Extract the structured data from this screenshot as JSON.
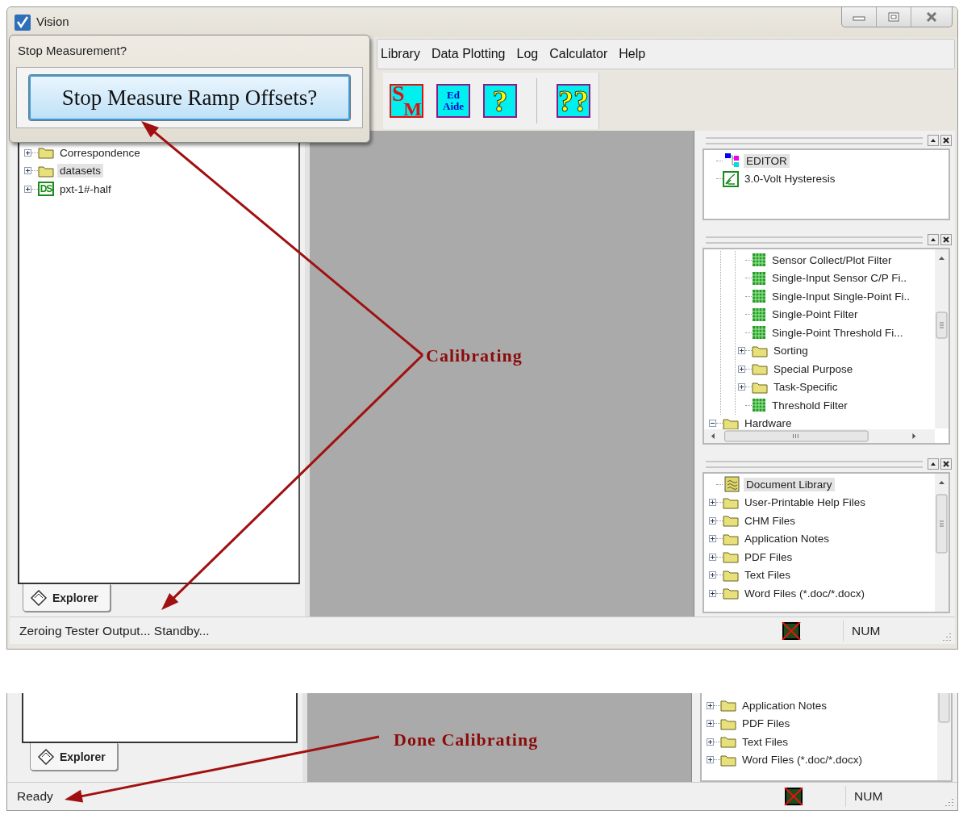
{
  "window": {
    "title": "Vision"
  },
  "dialog": {
    "title": "Stop Measurement?",
    "button": "Stop Measure Ramp Offsets?"
  },
  "menu": [
    "Library",
    "Data Plotting",
    "Log",
    "Calculator",
    "Help"
  ],
  "toolbar": [
    {
      "kind": "sm",
      "text": [
        "S",
        "M"
      ]
    },
    {
      "kind": "stack",
      "text": [
        "Ed",
        "Aide"
      ]
    },
    {
      "kind": "glyph",
      "text": [
        "?"
      ]
    },
    {
      "kind": "glyph",
      "text": [
        "??"
      ]
    }
  ],
  "explorer": {
    "items": [
      {
        "kind": "folder",
        "label": "Correspondence",
        "expanded": false,
        "selected": false
      },
      {
        "kind": "folder",
        "label": "datasets",
        "expanded": false,
        "selected": true
      },
      {
        "kind": "dataset",
        "badge": "DS",
        "label": "pxt-1#-half",
        "expanded": false,
        "selected": false
      }
    ],
    "tab": "Explorer"
  },
  "right_panels": [
    {
      "items": [
        {
          "kind": "editor",
          "label": "EDITOR",
          "selected": true
        },
        {
          "kind": "graph",
          "label": "3.0-Volt Hysteresis",
          "selected": false
        }
      ]
    },
    {
      "items": [
        {
          "kind": "scrolled",
          "children": [
            {
              "kind": "scrolled",
              "children": [
                {
                  "kind": "filter",
                  "label": "Sensor Collect/Plot Filter",
                  "selected": false
                },
                {
                  "kind": "filter",
                  "label": "Single-Input Sensor C/P Fi..",
                  "selected": false
                },
                {
                  "kind": "filter",
                  "label": "Single-Input Single-Point Fi..",
                  "selected": false
                },
                {
                  "kind": "filter",
                  "label": "Single-Point Filter",
                  "selected": false
                },
                {
                  "kind": "filter",
                  "label": "Single-Point Threshold Fi...",
                  "selected": false
                },
                {
                  "kind": "folder",
                  "label": "Sorting",
                  "expanded": false,
                  "selected": false
                },
                {
                  "kind": "folder",
                  "label": "Special Purpose",
                  "expanded": false,
                  "selected": false
                },
                {
                  "kind": "folder",
                  "label": "Task-Specific",
                  "expanded": false,
                  "selected": false
                },
                {
                  "kind": "filter",
                  "label": "Threshold Filter",
                  "selected": false
                }
              ]
            }
          ]
        },
        {
          "kind": "folder",
          "label": "Hardware",
          "expanded": true,
          "selected": false
        }
      ]
    },
    {
      "items": [
        {
          "kind": "library",
          "label": "Document Library",
          "selected": true
        },
        {
          "kind": "folder",
          "label": "User-Printable Help Files",
          "expanded": false,
          "selected": false
        },
        {
          "kind": "folder",
          "label": "CHM Files",
          "expanded": false,
          "selected": false
        },
        {
          "kind": "folder",
          "label": "Application Notes",
          "expanded": false,
          "selected": false
        },
        {
          "kind": "folder",
          "label": "PDF Files",
          "expanded": false,
          "selected": false
        },
        {
          "kind": "folder",
          "label": "Text Files",
          "expanded": false,
          "selected": false
        },
        {
          "kind": "folder",
          "label": "Word Files (*.doc/*.docx)",
          "expanded": false,
          "selected": false
        }
      ]
    }
  ],
  "status_bar": {
    "message": "Zeroing Tester Output... Standby...",
    "indicator": "NUM"
  },
  "annotations": [
    {
      "kind": "fork",
      "label": "Calibrating"
    },
    {
      "kind": "single",
      "label": "Done Calibrating"
    }
  ],
  "second_view": {
    "tab": "Explorer",
    "items": [
      {
        "kind": "folder",
        "label": "Application Notes",
        "expanded": false,
        "selected": false
      },
      {
        "kind": "folder",
        "label": "PDF Files",
        "expanded": false,
        "selected": false
      },
      {
        "kind": "folder",
        "label": "Text Files",
        "expanded": false,
        "selected": false
      },
      {
        "kind": "folder",
        "label": "Word Files (*.doc/*.docx)",
        "expanded": false,
        "selected": false
      }
    ],
    "status_bar": {
      "message": "Ready",
      "indicator": "NUM"
    }
  }
}
